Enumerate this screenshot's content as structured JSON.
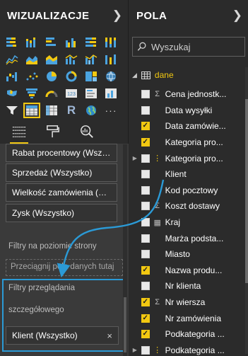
{
  "visualizations": {
    "title": "WIZUALIZACJE",
    "icons": [
      "stacked-bar-icon",
      "stacked-column-icon",
      "clustered-bar-icon",
      "clustered-column-icon",
      "100-bar-icon",
      "100-column-icon",
      "line-chart-icon",
      "area-chart-icon",
      "stacked-area-icon",
      "line-column-icon",
      "line-clustered-icon",
      "ribbon-chart-icon",
      "waterfall-icon",
      "scatter-icon",
      "pie-chart-icon",
      "donut-chart-icon",
      "treemap-icon",
      "map-icon",
      "filled-map-icon",
      "funnel-icon",
      "gauge-icon",
      "card-icon",
      "multirow-card-icon",
      "kpi-icon",
      "slicer-icon",
      "table-icon",
      "matrix-icon",
      "r-visual-icon",
      "globe-icon",
      "more-icon"
    ],
    "tabs": [
      "fields-tab",
      "format-tab",
      "analytics-tab"
    ],
    "filter_cards": [
      "Rabat procentowy (Wszy...",
      "Sprzedaż (Wszystko)",
      "Wielkość zamówienia (W...",
      "Zysk (Wszystko)"
    ],
    "page_filters_label": "Filtry na poziomie strony",
    "drop_zone_text": "Przeciągnij pola danych tutaj",
    "drillthrough_label_1": "Filtry przeglądania",
    "drillthrough_label_2": "szczegółowego",
    "drillthrough_card": "Klient (Wszystko)",
    "close_glyph": "×"
  },
  "fields": {
    "title": "POLA",
    "search_placeholder": "Wyszukaj",
    "table_name": "dane",
    "items": [
      {
        "name": "Cena jednostk...",
        "checked": false,
        "icon": "sigma",
        "expand": false
      },
      {
        "name": "Data wysyłki",
        "checked": false,
        "icon": "none",
        "expand": false
      },
      {
        "name": "Data zamówie...",
        "checked": true,
        "icon": "none",
        "expand": false
      },
      {
        "name": "Kategoria pro...",
        "checked": true,
        "icon": "none",
        "expand": false
      },
      {
        "name": "Kategoria pro...",
        "checked": false,
        "icon": "hierarchy",
        "expand": true
      },
      {
        "name": "Klient",
        "checked": false,
        "icon": "none",
        "expand": false
      },
      {
        "name": "Kod pocztowy",
        "checked": false,
        "icon": "none",
        "expand": false
      },
      {
        "name": "Koszt dostawy",
        "checked": false,
        "icon": "sigma",
        "expand": false
      },
      {
        "name": "Kraj",
        "checked": false,
        "icon": "geo",
        "expand": false
      },
      {
        "name": "Marża podsta...",
        "checked": false,
        "icon": "none",
        "expand": false
      },
      {
        "name": "Miasto",
        "checked": false,
        "icon": "none",
        "expand": false
      },
      {
        "name": "Nazwa produ...",
        "checked": true,
        "icon": "none",
        "expand": false
      },
      {
        "name": "Nr klienta",
        "checked": false,
        "icon": "none",
        "expand": false
      },
      {
        "name": "Nr wiersza",
        "checked": true,
        "icon": "sigma",
        "expand": false
      },
      {
        "name": "Nr zamówienia",
        "checked": true,
        "icon": "none",
        "expand": false
      },
      {
        "name": "Podkategoria ...",
        "checked": true,
        "icon": "none",
        "expand": false
      },
      {
        "name": "Podkategoria ...",
        "checked": false,
        "icon": "hierarchy",
        "expand": true
      }
    ]
  },
  "colors": {
    "accent": "#f2c811",
    "highlight": "#2b9ad6",
    "background": "#2b2b2b"
  }
}
